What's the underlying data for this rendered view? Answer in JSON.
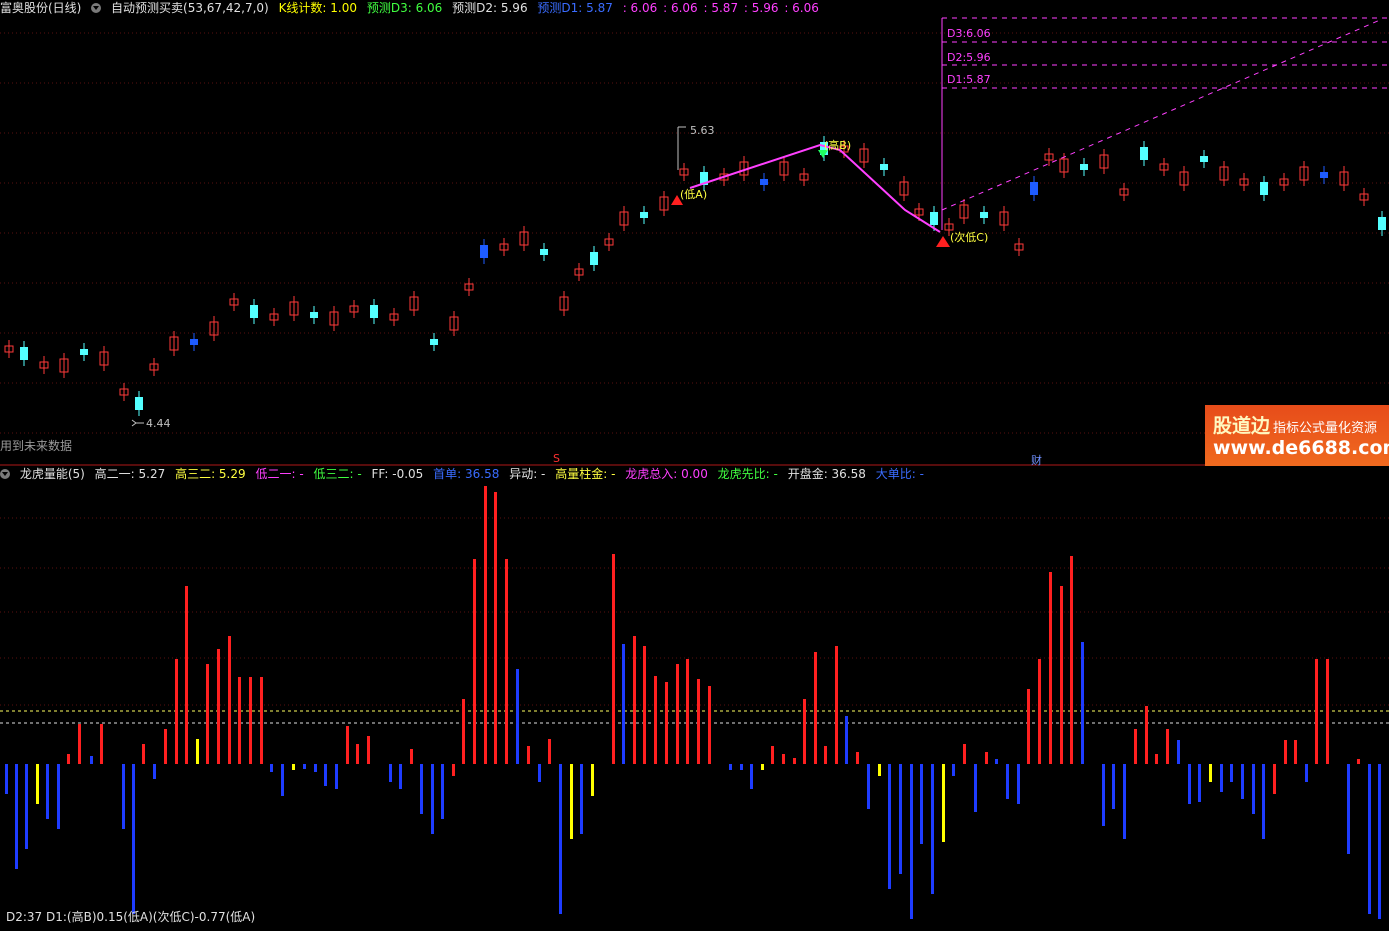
{
  "main_header": {
    "stock": "富奥股份(日线)",
    "indicator": "自动预测买卖(53,67,42,7,0)",
    "k_count": "K线计数: 1.00",
    "pred_d3": "预测D3: 6.06",
    "pred_d2": "预测D2: 5.96",
    "pred_d1": "预测D1: 5.87",
    "v1": ": 6.06",
    "v2": ": 6.06",
    "v3": ": 5.87",
    "v4": ": 5.96",
    "v5": ": 6.06"
  },
  "annotations": {
    "high_price": "5.63",
    "low_price": "4.44",
    "d3": "D3:6.06",
    "d2": "D2:5.96",
    "d1": "D1:5.87",
    "high_b": "(高B)",
    "low_a": "(低A)",
    "low_c": "(次低C)",
    "future_data": "用到未来数据",
    "marker_s": "S",
    "marker_cai": "财"
  },
  "sub_header": {
    "name": "龙虎量能(5)",
    "g2": "高二一: 5.27",
    "g3": "高三二: 5.29",
    "d2": "低二一: -",
    "d3": "低三二: -",
    "ff": "FF: -0.05",
    "sb": "首单: 36.58",
    "yd": "异动: -",
    "glzj": "高量柱金: -",
    "lhzr": "龙虎总入: 0.00",
    "lhxb": "龙虎先比: -",
    "kpj": "开盘金: 36.58",
    "ddb": "大单比: -"
  },
  "footer": "D2:37  D1:(高B)0.15(低A)(次低C)-0.77(低A)",
  "watermark": {
    "brand": "股道边",
    "tagline": "指标公式量化资源",
    "url": "www.de6688.com"
  },
  "colors": {
    "up": "#ff3a3a",
    "down": "#54ffff",
    "down_dark": "#1e5cff",
    "magenta": "#ff40ff",
    "yellow": "#ffff00"
  }
}
